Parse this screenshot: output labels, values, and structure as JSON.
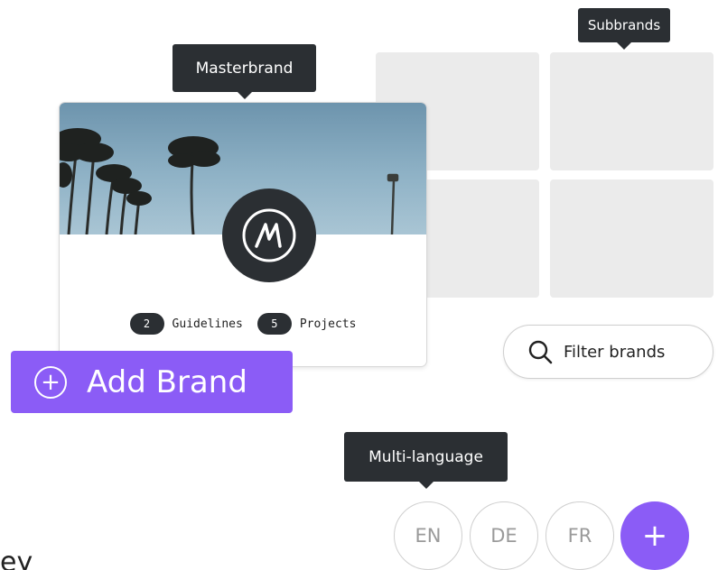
{
  "tooltips": {
    "subbrands": "Subbrands",
    "masterbrand": "Masterbrand",
    "multi_language": "Multi-language"
  },
  "masterbrand_card": {
    "logo_letter": "M",
    "guidelines_count": "2",
    "guidelines_label": "Guidelines",
    "projects_count": "5",
    "projects_label": "Projects"
  },
  "add_brand": {
    "label": "Add Brand",
    "icon": "plus-circle-icon"
  },
  "filter": {
    "label": "Filter brands",
    "icon": "search-icon"
  },
  "languages": [
    {
      "code": "EN"
    },
    {
      "code": "DE"
    },
    {
      "code": "FR"
    }
  ],
  "language_add": {
    "icon": "plus-icon",
    "glyph": "+"
  },
  "partial_text": "ey",
  "colors": {
    "accent": "#8b5cf6",
    "dark": "#2b2f33",
    "tile": "#ebebeb"
  }
}
